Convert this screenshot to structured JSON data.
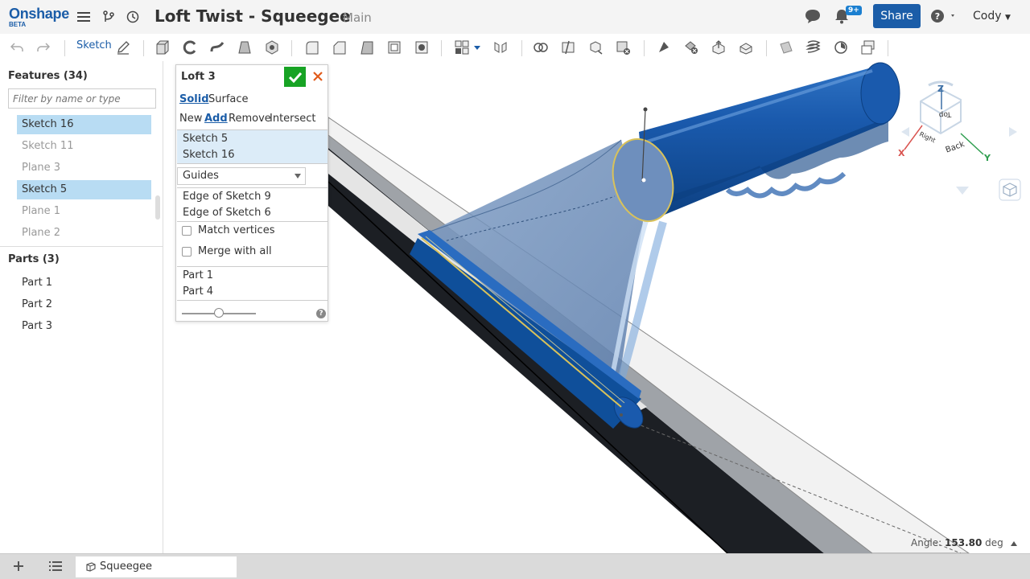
{
  "app": {
    "logo": "Onshape",
    "logo_sub": "BETA"
  },
  "document": {
    "title": "Loft Twist - Squeegee",
    "branch": "Main"
  },
  "topbar": {
    "notification_badge": "9+",
    "share_label": "Share",
    "user_name": "Cody"
  },
  "toolbar": {
    "sketch_label": "Sketch"
  },
  "features": {
    "header": "Features (34)",
    "filter_placeholder": "Filter by name or type",
    "items": [
      {
        "label": "Sketch 16",
        "selected": true
      },
      {
        "label": "Sketch 11",
        "selected": false
      },
      {
        "label": "Plane 3",
        "selected": false
      },
      {
        "label": "Sketch 5",
        "selected": true
      },
      {
        "label": "Plane 1",
        "selected": false
      },
      {
        "label": "Plane 2",
        "selected": false
      }
    ]
  },
  "parts": {
    "header": "Parts (3)",
    "items": [
      "Part 1",
      "Part 2",
      "Part 3"
    ]
  },
  "loft_dialog": {
    "title": "Loft 3",
    "body_types": [
      "Solid",
      "Surface"
    ],
    "body_type_selected": "Solid",
    "operations": [
      "New",
      "Add",
      "Remove",
      "Intersect"
    ],
    "operation_selected": "Add",
    "profiles": [
      "Sketch 5",
      "Sketch 16"
    ],
    "guides_dropdown": "Guides",
    "guides": [
      "Edge of Sketch 9",
      "Edge of Sketch 6"
    ],
    "match_vertices_label": "Match vertices",
    "match_vertices": false,
    "merge_with_all_label": "Merge with all",
    "merge_with_all": false,
    "merge_scope": [
      "Part 1",
      "Part 4"
    ]
  },
  "viewcube": {
    "axes": [
      "Z",
      "X",
      "Y"
    ],
    "faces": [
      "Top",
      "Right",
      "Back"
    ]
  },
  "viewport": {
    "angle_label": "Angle:",
    "angle_value": "153.80",
    "angle_unit": "deg"
  },
  "bottombar": {
    "tab_label": "Squeegee"
  },
  "colors": {
    "brand": "#1b5da8",
    "part_blue": "#0f4f9a",
    "ok_green": "#17a324",
    "selection": "#b8dcf3"
  }
}
